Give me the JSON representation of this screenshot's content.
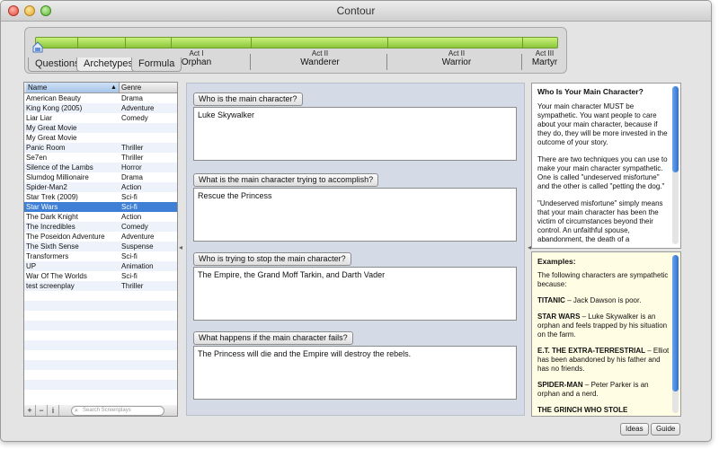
{
  "window": {
    "title": "Contour"
  },
  "structure": {
    "tabs": [
      {
        "label": "Questions"
      },
      {
        "label": "Archetypes"
      },
      {
        "label": "Formula"
      }
    ],
    "acts": [
      {
        "num": "Act I",
        "name": "Orphan"
      },
      {
        "num": "Act II",
        "name": "Wanderer"
      },
      {
        "num": "Act II",
        "name": "Warrior"
      },
      {
        "num": "Act III",
        "name": "Martyr"
      }
    ]
  },
  "screenplays": {
    "columns": {
      "name": "Name",
      "sort_indicator": "▲",
      "genre": "Genre"
    },
    "rows": [
      {
        "name": "American Beauty",
        "genre": "Drama"
      },
      {
        "name": "King Kong (2005)",
        "genre": "Adventure"
      },
      {
        "name": "Liar Liar",
        "genre": "Comedy"
      },
      {
        "name": "My Great Movie",
        "genre": ""
      },
      {
        "name": "My Great Movie",
        "genre": ""
      },
      {
        "name": "Panic Room",
        "genre": "Thriller"
      },
      {
        "name": "Se7en",
        "genre": "Thriller"
      },
      {
        "name": "Silence of the Lambs",
        "genre": "Horror"
      },
      {
        "name": "Slumdog Millionaire",
        "genre": "Drama"
      },
      {
        "name": "Spider-Man2",
        "genre": "Action"
      },
      {
        "name": "Star Trek (2009)",
        "genre": "Sci-fi"
      },
      {
        "name": "Star Wars",
        "genre": "Sci-fi"
      },
      {
        "name": "The Dark Knight",
        "genre": "Action"
      },
      {
        "name": "The Incredibles",
        "genre": "Comedy"
      },
      {
        "name": "The Poseidon Adventure",
        "genre": "Adventure"
      },
      {
        "name": "The Sixth Sense",
        "genre": "Suspense"
      },
      {
        "name": "Transformers",
        "genre": "Sci-fi"
      },
      {
        "name": "UP",
        "genre": "Animation"
      },
      {
        "name": "War Of The Worlds",
        "genre": "Sci-fi"
      },
      {
        "name": "test screenplay",
        "genre": "Thriller"
      }
    ],
    "selected_index": 11,
    "footer": {
      "add": "+",
      "remove": "−",
      "info": "i",
      "search_placeholder": "Search Screenplays"
    }
  },
  "questions": [
    {
      "label": "Who is the main character?",
      "answer": "Luke Skywalker"
    },
    {
      "label": "What is the main character trying to accomplish?",
      "answer": "Rescue the Princess"
    },
    {
      "label": "Who is trying to stop the main character?",
      "answer": "The Empire, the Grand Moff Tarkin, and Darth Vader"
    },
    {
      "label": "What happens if the main character fails?",
      "answer": "The Princess will die and the Empire will destroy the rebels."
    }
  ],
  "guide": {
    "title": "Who Is Your Main Character?",
    "paragraphs": [
      "Your main character MUST be sympathetic.  You want people to care about your main character, because if they do, they will be more invested in the outcome of your story.",
      "There are two techniques you can use to make your main character sympathetic.  One is called \"undeserved misfortune\" and the other is called \"petting the dog.\"",
      "\"Undeserved misfortune\" simply means that your main character has been the victim of circumstances beyond their control.  An unfaithful spouse, abandonment, the death of a"
    ]
  },
  "examples": {
    "title": "Examples:",
    "intro": "The following characters are sympathetic because:",
    "items": [
      {
        "film": "TITANIC",
        "text": " – Jack Dawson is poor."
      },
      {
        "film": "STAR WARS",
        "text": " – Luke Skywalker is an orphan and feels trapped by his situation on the farm."
      },
      {
        "film": "E.T. THE EXTRA-TERRESTRIAL",
        "text": " – Elliot has been abandoned by his father and has no friends."
      },
      {
        "film": "SPIDER-MAN",
        "text": " – Peter Parker is an orphan and a nerd."
      },
      {
        "film": "THE GRINCH WHO STOLE",
        "text": ""
      }
    ]
  },
  "bottom_buttons": {
    "ideas": "Ideas",
    "guide": "Guide"
  }
}
